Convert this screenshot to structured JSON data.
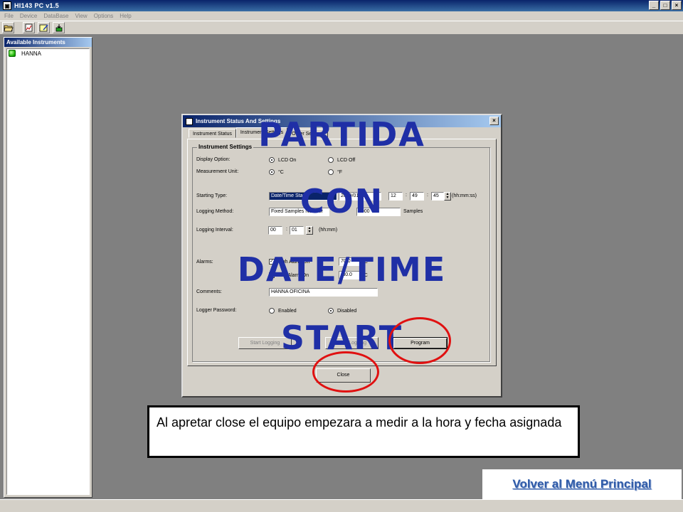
{
  "window": {
    "title": "HI143 PC v1.5",
    "buttons": [
      "_",
      "□",
      "×"
    ]
  },
  "menu": [
    "File",
    "Device",
    "DataBase",
    "View",
    "Options",
    "Help"
  ],
  "toolbar": {
    "icons": [
      "open-folder-icon",
      "report-icon",
      "edit-icon",
      "download-icon"
    ]
  },
  "instruments": {
    "title": "Available Instruments",
    "items": [
      {
        "name": "HANNA",
        "status_color": "#18b000"
      }
    ]
  },
  "dialog": {
    "title": "Instrument Status And Settings",
    "tabs": [
      "Instrument Status",
      "Instrument Settings",
      "Other Settings"
    ],
    "group_title": "Instrument Settings",
    "display_option": {
      "label": "Display Option:",
      "opt1": "LCD On",
      "opt2": "LCD Off",
      "selected": "LCD On"
    },
    "measurement_unit": {
      "label": "Measurement Unit:",
      "opt1": "°C",
      "opt2": "°F",
      "selected": "°C"
    },
    "starting_type": {
      "label": "Starting Type:",
      "value": "Date/Time Start",
      "date": "2009/01/13",
      "hh": "12",
      "mm": "49",
      "ss": "45",
      "format": "(hh:mm:ss)"
    },
    "logging_method": {
      "label": "Logging Method:",
      "value": "Fixed Samples Number",
      "samples": "4000",
      "samples_label": "Samples"
    },
    "logging_interval": {
      "label": "Logging Interval:",
      "hh": "00",
      "mm": "01",
      "format": "(hh:mm)"
    },
    "alarms": {
      "label": "Alarms:",
      "high": "High Alarm On",
      "high_value": "70.0",
      "low": "Low Alarm On",
      "low_value": "-30.0",
      "unit": "°C"
    },
    "comments": {
      "label": "Comments:",
      "value": "HANNA OFICINA"
    },
    "password": {
      "label": "Logger Password:",
      "opt1": "Enabled",
      "opt2": "Disabled",
      "selected": "Disabled"
    },
    "start_logging": "Start Logging",
    "stop_logging": "Stop Logging",
    "program": "Program",
    "close": "Close"
  },
  "overlay": {
    "line1": "PARTIDA",
    "line2": "CON",
    "line3": "DATE/TIME",
    "line4": "START",
    "color": "#1f2fa6"
  },
  "caption": "Al apretar close el equipo empezara a medir a la hora y fecha asignada",
  "back_link": "Volver al Menú Principal"
}
